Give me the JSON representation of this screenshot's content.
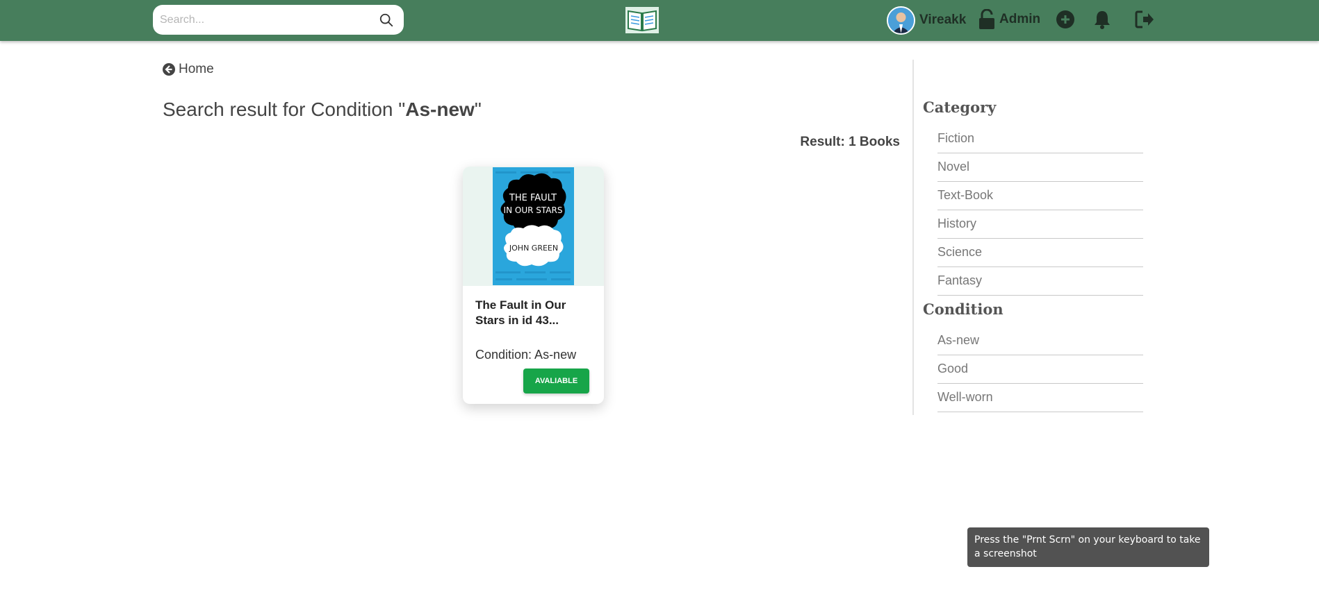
{
  "header": {
    "search_placeholder": "Search...",
    "username": "Vireakk",
    "admin_label": "Admin"
  },
  "nav": {
    "back_label": "Home"
  },
  "search_title": {
    "prefix": "Search result for Condition \"",
    "term": "As-new",
    "suffix": "\""
  },
  "result_count": "Result: 1 Books",
  "books": [
    {
      "title": "The Fault in Our Stars in id 43...",
      "condition": "Condition: As-new",
      "status": "AVALIABLE"
    }
  ],
  "sidebar": {
    "category_heading": "Category",
    "categories": [
      "Fiction",
      "Novel",
      "Text-Book",
      "History",
      "Science",
      "Fantasy"
    ],
    "condition_heading": "Condition",
    "conditions": [
      "As-new",
      "Good",
      "Well-worn"
    ]
  },
  "tooltip": "Press the \"Prnt Scrn\" on your keyboard to take a screenshot",
  "colors": {
    "header_bg": "#477e5c",
    "available_button": "#17a549",
    "cover_blue": "#2aa6dc"
  },
  "icons": [
    "search-icon",
    "book-logo-icon",
    "lock-open-icon",
    "add-circle-icon",
    "bell-icon",
    "logout-icon",
    "arrow-left-circle-icon"
  ]
}
